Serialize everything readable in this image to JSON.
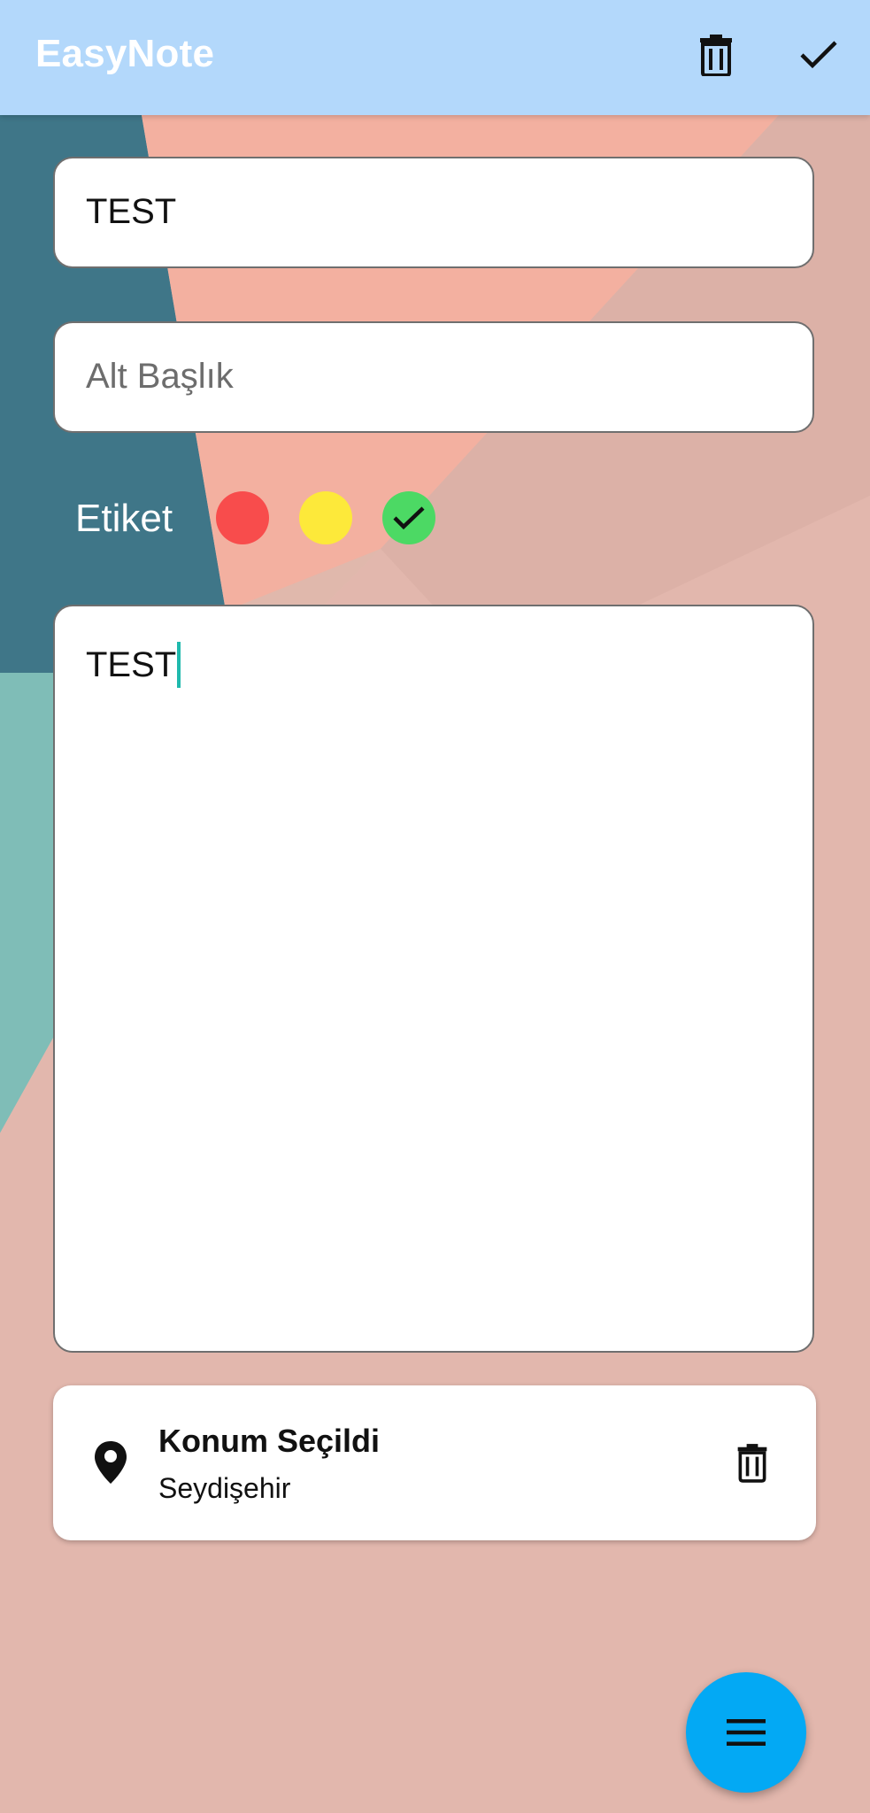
{
  "app": {
    "title": "EasyNote"
  },
  "appbar": {
    "delete_icon": "trash-icon",
    "save_icon": "check-icon"
  },
  "form": {
    "title_value": "TEST",
    "subtitle_placeholder": "Alt Başlık",
    "body_value": "TEST"
  },
  "labels": {
    "label_text": "Etiket",
    "colors": [
      {
        "name": "red",
        "hex": "#f84c4c",
        "selected": false
      },
      {
        "name": "yellow",
        "hex": "#fde93a",
        "selected": false
      },
      {
        "name": "green",
        "hex": "#4cd964",
        "selected": true
      }
    ]
  },
  "location": {
    "title": "Konum Seçildi",
    "subtitle": "Seydişehir",
    "pin_icon": "location-pin-icon",
    "delete_icon": "trash-icon"
  },
  "fab": {
    "icon": "menu-icon",
    "color": "#03a9f4"
  },
  "theme": {
    "appbar_color": "#b3d8fb",
    "caret_color": "#1fb9ad"
  }
}
